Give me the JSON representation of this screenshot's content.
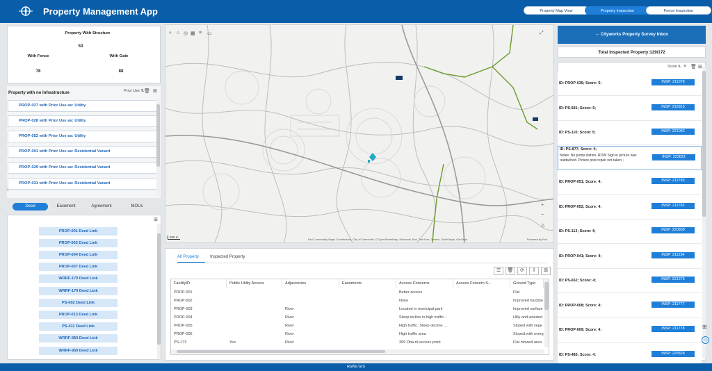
{
  "header": {
    "title": "Property Management App",
    "nav": [
      "Property Map View",
      "Property Inspection",
      "Fence Inspection"
    ],
    "active_nav": "Property Inspection"
  },
  "stats": {
    "structure_label": "Property With Structure",
    "structure_value": "53",
    "fence_label": "With Fence",
    "fence_value": "78",
    "gate_label": "With Gate",
    "gate_value": "88"
  },
  "no_infra": {
    "title": "Property with no Infrastructure",
    "sort_label": "Prior Use",
    "items": [
      "PROP-027 with Prior Use as: Utility",
      "PROP-028 with Prior Use as: Utility",
      "PROP-052 with Prior Use as: Utility",
      "PROP-001 with Prior Use as: Residential Vacant",
      "PROP-029 with Prior Use as: Residential Vacant",
      "PROP-031 with Prior Use as: Residential Vacant"
    ]
  },
  "doc_tabs": [
    "Deed",
    "Easement",
    "Agreement",
    "MOUs"
  ],
  "deed_links": [
    "PROP-001 Deed Link",
    "PROP-002 Deed Link",
    "PROP-004 Deed Link",
    "PROP-007 Deed Link",
    "WRRF-170 Deed Link",
    "WRRF-170 Deed Link",
    "PS-602 Deed Link",
    "PROP-013 Deed Link",
    "PS-411 Deed Link",
    "WRRF-950 Deed Link",
    "WRRF-950 Deed Link"
  ],
  "map": {
    "scale": "200 m",
    "attribution": "Esri Community Maps Contributors, City of Greenville, © OpenStreetMap, Microsoft, Esri, TomTom, Garmin, SafeGraph, GeoTech...",
    "powered_by": "Powered by Esri"
  },
  "grid": {
    "tabs": [
      "All Property",
      "Inspected Property"
    ],
    "columns": [
      "FacilityID",
      "Public Utility Access",
      "Adjacencies",
      "Easements",
      "Access Concerns",
      "Access Concern S...",
      "Ground Type"
    ],
    "rows": [
      [
        "PROP-001",
        "",
        "",
        "",
        "Better access",
        "",
        "Flat"
      ],
      [
        "PROP-002",
        "",
        "",
        "",
        "None",
        "",
        "Improved hardste"
      ],
      [
        "PROP-003",
        "",
        "River",
        "",
        "Located in municipal park",
        "",
        "Improved surface"
      ],
      [
        "PROP-004",
        "",
        "River",
        "",
        "Steep incline in high traffic...",
        "",
        "Hilly and wooded"
      ],
      [
        "PROP-005",
        "",
        "River",
        "",
        "High traffic. Steep decline ...",
        "",
        "Sloped with vege"
      ],
      [
        "PROP-006",
        "",
        "River",
        "",
        "High traffic area",
        "",
        "Sloped with overg"
      ],
      [
        "PS-173",
        "Yes",
        "River",
        "",
        "399 Oba rd access point",
        "",
        "Flat mowed area"
      ]
    ]
  },
  "inbox": {
    "title": "Cityworks Property Survey Inbox",
    "total": "Total Inspected Property:129/172",
    "sort_label": "Score",
    "items": [
      {
        "id": "ID: PROP-035; Score: 5;",
        "insp": "INSP: 211078",
        "note": ""
      },
      {
        "id": "ID: PS-681; Score: 5;",
        "insp": "INSP: 216915",
        "note": ""
      },
      {
        "id": "ID: PS-110; Score: 5;",
        "insp": "INSP: 221062",
        "note": ""
      },
      {
        "id": "ID: PS-877; Score: 4;",
        "insp": "INSP: 223622",
        "note": "Notes: No pump station. ROW Sign in picture was reattached. Picture post repair not taken.;"
      },
      {
        "id": "ID: PROP-051; Score: 4;",
        "insp": "INSP: 211783",
        "note": ""
      },
      {
        "id": "ID: PROP-052; Score: 4;",
        "insp": "INSP: 211782",
        "note": ""
      },
      {
        "id": "ID: PS-113; Score: 4;",
        "insp": "INSP: 220809",
        "note": ""
      },
      {
        "id": "ID: PROP-041; Score: 4;",
        "insp": "INSP: 211254",
        "note": ""
      },
      {
        "id": "ID: PS-652; Score: 4;",
        "insp": "INSP: 221276",
        "note": ""
      },
      {
        "id": "ID: PROP-008; Score: 4;",
        "insp": "INSP: 211777",
        "note": ""
      },
      {
        "id": "ID: PROP-009; Score: 4;",
        "insp": "INSP: 211778",
        "note": ""
      },
      {
        "id": "ID: PS-485; Score: 4;",
        "insp": "INSP: 225828",
        "note": ""
      }
    ]
  },
  "footer": "RaWa GIS",
  "colors": {
    "brand": "#0a5da8",
    "accent": "#1f7fd8",
    "link": "#1d64b8",
    "map_line": "#6a9a2a"
  }
}
